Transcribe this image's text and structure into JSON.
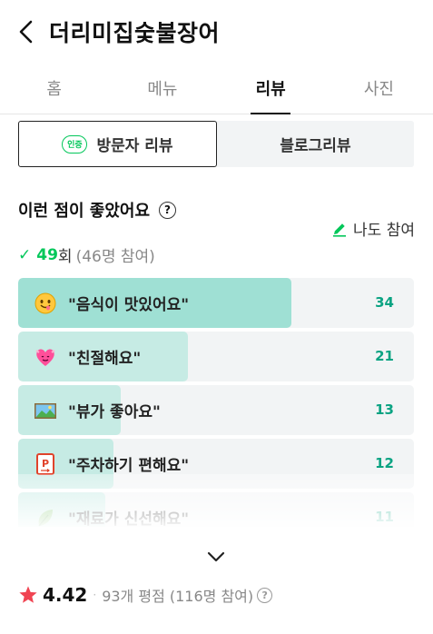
{
  "header": {
    "title": "더리미집숯불장어",
    "back_icon": "chevron-left-icon"
  },
  "tabs": [
    {
      "label": "홈",
      "active": false
    },
    {
      "label": "메뉴",
      "active": false
    },
    {
      "label": "리뷰",
      "active": true
    },
    {
      "label": "사진",
      "active": false
    }
  ],
  "segment": {
    "visitor_label": "방문자 리뷰",
    "visitor_badge": "인증",
    "blog_label": "블로그리뷰",
    "active": "visitor"
  },
  "section": {
    "title": "이런 점이 좋았어요",
    "join_label": "나도 참여",
    "count": "49",
    "count_unit": "회",
    "count_sub": "(46명 참여)"
  },
  "keywords": [
    {
      "label": "\"음식이 맛있어요\"",
      "count": "34",
      "icon": "smiley-emoji-icon",
      "fraction": 0.69
    },
    {
      "label": "\"친절해요\"",
      "count": "21",
      "icon": "heart-emoji-icon",
      "fraction": 0.43
    },
    {
      "label": "\"뷰가 좋아요\"",
      "count": "13",
      "icon": "landscape-emoji-icon",
      "fraction": 0.26
    },
    {
      "label": "\"주차하기 편해요\"",
      "count": "12",
      "icon": "parking-emoji-icon",
      "fraction": 0.24
    },
    {
      "label": "\"재료가 신선해요\"",
      "count": "11",
      "icon": "leaf-emoji-icon",
      "fraction": 0.22
    }
  ],
  "rating": {
    "score": "4.42",
    "sub": "93개 평점 (116명 참여)"
  },
  "colors": {
    "accent_green": "#03c75a",
    "bar_fill": "#c6ebe4",
    "bar_fill_top": "#9fe0d4",
    "count_teal": "#0aa382",
    "star_red": "#f04452"
  }
}
